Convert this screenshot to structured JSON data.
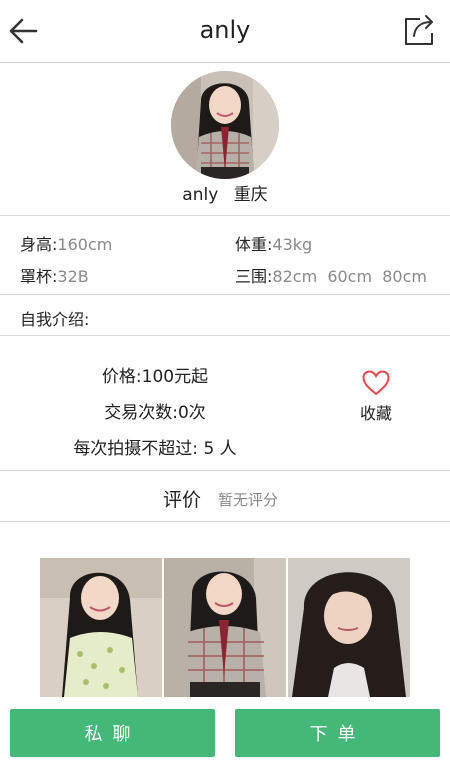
{
  "header": {
    "title": "anly",
    "back_icon": "arrow-left-icon",
    "share_icon": "share-icon"
  },
  "profile": {
    "name": "anly",
    "city": "重庆"
  },
  "stats": {
    "height_label": "身高:",
    "height_value": "160cm",
    "weight_label": "体重:",
    "weight_value": "43kg",
    "cup_label": "罩杯:",
    "cup_value": "32B",
    "measurements_label": "三围:",
    "measurements_value": "82cm  60cm  80cm"
  },
  "intro": {
    "label": "自我介绍:"
  },
  "pricing": {
    "price": "价格:100元起",
    "trade_count": "交易次数:0次",
    "max_people": "每次拍摄不超过: 5 人"
  },
  "favorite": {
    "label": "收藏",
    "icon": "heart-icon",
    "color": "#e5474b"
  },
  "rating": {
    "title": "评价",
    "empty_text": "暂无评分"
  },
  "actions": {
    "chat_label": "私聊",
    "order_label": "下单",
    "button_color": "#44b876"
  }
}
